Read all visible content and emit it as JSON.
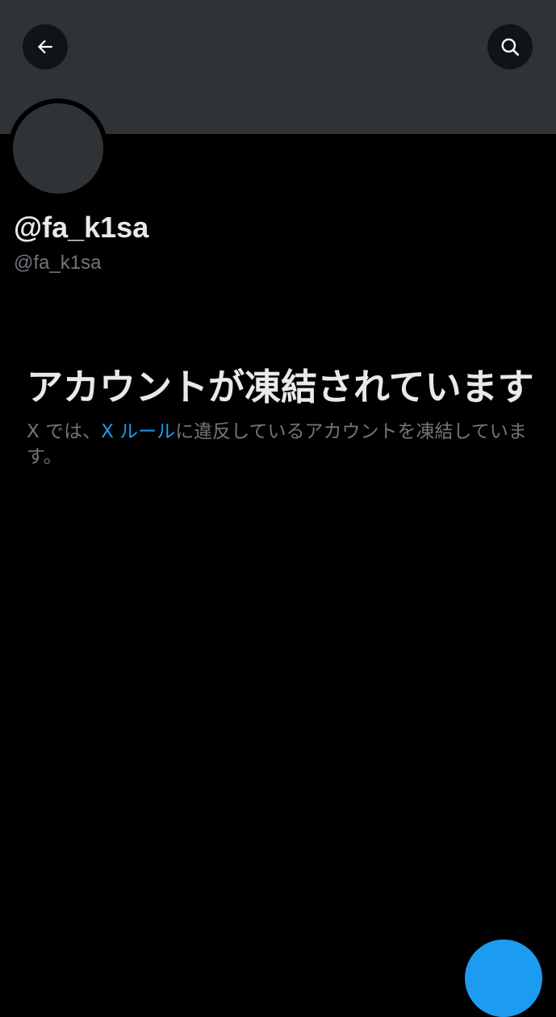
{
  "profile": {
    "display_name": "@fa_k1sa",
    "handle": "@fa_k1sa"
  },
  "toolbar": {
    "back_icon": "arrow-left-icon",
    "search_icon": "search-icon"
  },
  "suspension": {
    "title": "アカウントが凍結されています",
    "description_prefix": "X では、",
    "rules_link": "X ルール",
    "description_suffix": "に違反しているアカウントを凍結しています。"
  },
  "colors": {
    "background": "#000000",
    "banner": "#2f3336",
    "link": "#1d9bf0",
    "secondary_text": "#71767b",
    "primary_text": "#e7e9ea",
    "fab": "#1d9bf0"
  }
}
